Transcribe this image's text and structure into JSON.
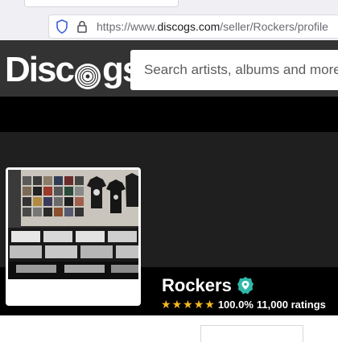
{
  "browser": {
    "url_prefix": "https://www.",
    "url_domain": "discogs.com",
    "url_path": "/seller/Rockers/profile"
  },
  "header": {
    "logo_text_left": "Disc",
    "logo_text_right": "gs",
    "search_placeholder": "Search artists, albums and more..."
  },
  "seller": {
    "name": "Rockers",
    "rating_percent": "100.0%",
    "ratings_count": "11,000 ratings",
    "stars": 5,
    "verified": true
  },
  "colors": {
    "header_bg": "#333333",
    "star": "#f5b921",
    "verified_badge": "#2fb8a9"
  }
}
